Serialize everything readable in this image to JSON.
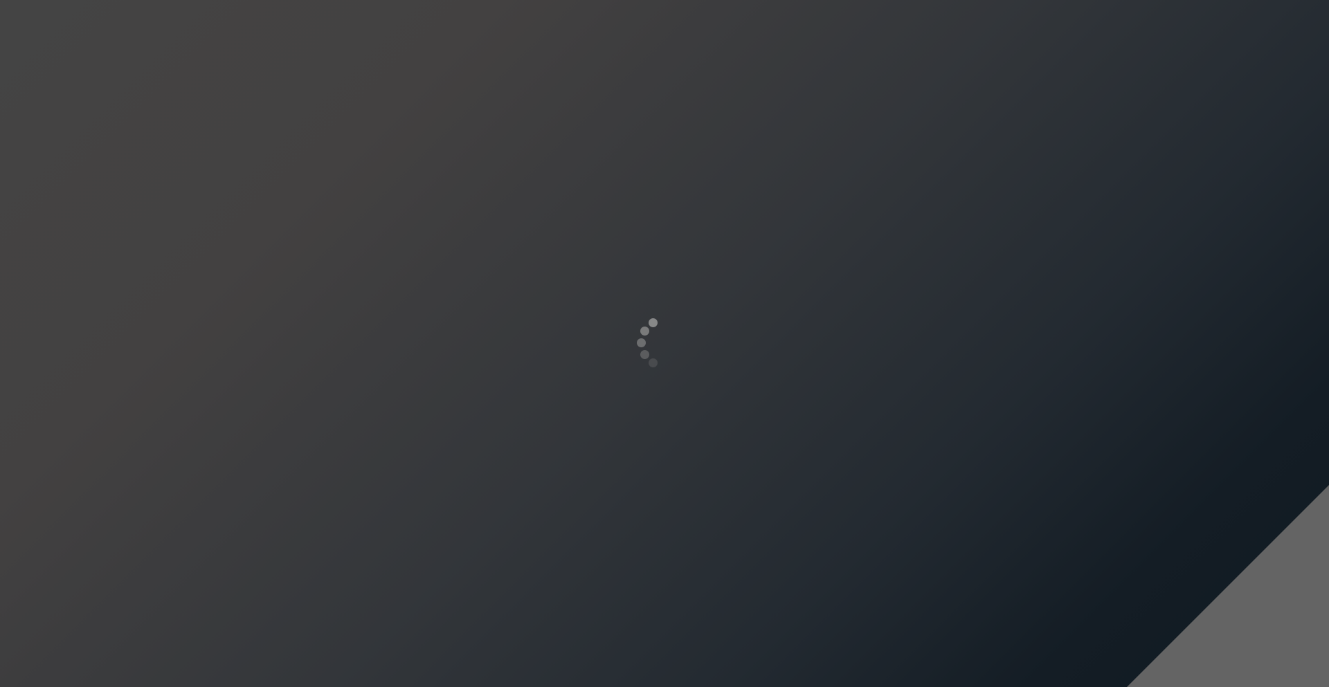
{
  "screen": {
    "state": "loading"
  },
  "loading_spinner": {
    "icon": "loading-spinner-icon",
    "dot_color": "#8c8c8c",
    "dot_opacities": [
      0.95,
      0.8,
      0.65,
      0.45,
      0.25
    ]
  },
  "corner_fold": {
    "color": "#646464"
  }
}
